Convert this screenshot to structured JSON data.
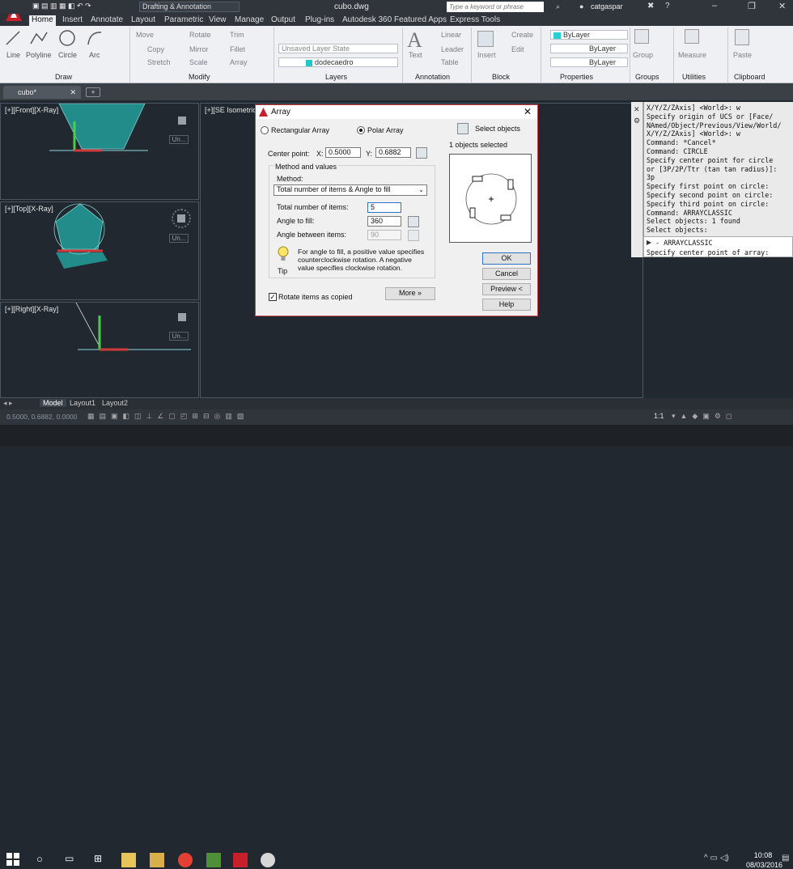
{
  "titlebar": {
    "workspace": "Drafting & Annotation",
    "file_title": "cubo.dwg",
    "search_placeholder": "Type a keyword or phrase",
    "user": "catgaspar"
  },
  "ribbon": {
    "tabs": [
      "Home",
      "Insert",
      "Annotate",
      "Layout",
      "Parametric",
      "View",
      "Manage",
      "Output",
      "Plug-ins",
      "Autodesk 360",
      "Featured Apps",
      "Express Tools"
    ],
    "active_tab": "Home",
    "draw": {
      "title": "Draw",
      "line": "Line",
      "polyline": "Polyline",
      "circle": "Circle",
      "arc": "Arc"
    },
    "modify": {
      "title": "Modify",
      "move": "Move",
      "rotate": "Rotate",
      "trim": "Trim",
      "copy": "Copy",
      "mirror": "Mirror",
      "fillet": "Fillet",
      "stretch": "Stretch",
      "scale": "Scale",
      "array": "Array"
    },
    "layers": {
      "title": "Layers",
      "layer_state": "Unsaved Layer State",
      "current_layer": "dodecaedro"
    },
    "annotation": {
      "title": "Annotation",
      "text": "Text",
      "linear": "Linear",
      "leader": "Leader",
      "table": "Table"
    },
    "block": {
      "title": "Block",
      "insert": "Insert",
      "create": "Create",
      "edit": "Edit"
    },
    "properties": {
      "title": "Properties",
      "color": "ByLayer",
      "linetype": "ByLayer",
      "lineweight": "ByLayer"
    },
    "groups": {
      "title": "Groups",
      "group": "Group"
    },
    "utilities": {
      "title": "Utilities",
      "measure": "Measure"
    },
    "clipboard": {
      "title": "Clipboard",
      "paste": "Paste"
    }
  },
  "filetab": {
    "name": "cubo*"
  },
  "viewports": {
    "front": "[+][Front][X-Ray]",
    "top": "[+][Top][X-Ray]",
    "right": "[+][Right][X-Ray]",
    "iso": "[+][SE Isometric][X",
    "unnamed": "Un..."
  },
  "dialog": {
    "title": "Array",
    "rectangular": "Rectangular Array",
    "polar": "Polar Array",
    "select_objects": "Select objects",
    "objects_selected": "1 objects selected",
    "center_point": "Center point:",
    "x_label": "X:",
    "x_value": "0.5000",
    "y_label": "Y:",
    "y_value": "0.6882",
    "method_and_values": "Method and values",
    "method_label": "Method:",
    "method_value": "Total number of items & Angle to fill",
    "total_items_label": "Total number of items:",
    "total_items_value": "5",
    "angle_fill_label": "Angle to fill:",
    "angle_fill_value": "360",
    "angle_between_label": "Angle between items:",
    "angle_between_value": "90",
    "tip_text": "For angle to fill, a positive value specifies counterclockwise rotation.  A negative value specifies clockwise rotation.",
    "tip_label": "Tip",
    "rotate_items": "Rotate items as copied",
    "more": "More",
    "ok": "OK",
    "cancel": "Cancel",
    "preview": "Preview <",
    "help": "Help"
  },
  "command": {
    "history": [
      "X/Y/Z/ZAxis] <World>: w",
      "Specify origin of UCS or [Face/",
      "NAmed/Object/Previous/View/World/",
      "X/Y/Z/ZAxis] <World>: w",
      "Command: *Cancel*",
      "Command: CIRCLE",
      "Specify center point for circle",
      "or [3P/2P/Ttr (tan tan radius)]:",
      "3p",
      "Specify first point on circle:",
      "Specify second point on circle:",
      "Specify third point on circle:",
      "Command: ARRAYCLASSIC",
      "Select objects: 1 found",
      "Select objects:"
    ],
    "current": "- ARRAYCLASSIC",
    "prompt": "Specify center point of array:"
  },
  "layout_tabs": [
    "Model",
    "Layout1",
    "Layout2"
  ],
  "status": {
    "coords": "0.5000, 0.6882, 0.0000",
    "scale": "1:1"
  },
  "taskbar": {
    "time": "10:08",
    "date": "08/03/2016"
  },
  "colors": {
    "accent": "#cc2222",
    "teal": "#2a8c8c",
    "ui_dark": "#30353c"
  }
}
